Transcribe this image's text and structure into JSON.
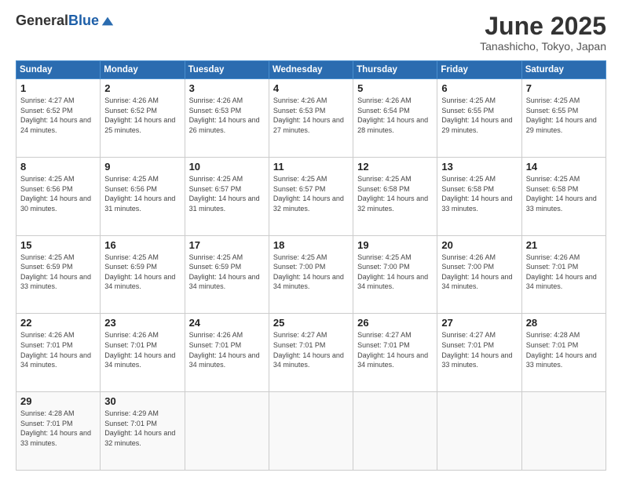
{
  "header": {
    "logo_general": "General",
    "logo_blue": "Blue",
    "month_title": "June 2025",
    "location": "Tanashicho, Tokyo, Japan"
  },
  "weekdays": [
    "Sunday",
    "Monday",
    "Tuesday",
    "Wednesday",
    "Thursday",
    "Friday",
    "Saturday"
  ],
  "weeks": [
    [
      {
        "num": "1",
        "sunrise": "4:27 AM",
        "sunset": "6:52 PM",
        "daylight": "14 hours and 24 minutes."
      },
      {
        "num": "2",
        "sunrise": "4:26 AM",
        "sunset": "6:52 PM",
        "daylight": "14 hours and 25 minutes."
      },
      {
        "num": "3",
        "sunrise": "4:26 AM",
        "sunset": "6:53 PM",
        "daylight": "14 hours and 26 minutes."
      },
      {
        "num": "4",
        "sunrise": "4:26 AM",
        "sunset": "6:53 PM",
        "daylight": "14 hours and 27 minutes."
      },
      {
        "num": "5",
        "sunrise": "4:26 AM",
        "sunset": "6:54 PM",
        "daylight": "14 hours and 28 minutes."
      },
      {
        "num": "6",
        "sunrise": "4:25 AM",
        "sunset": "6:55 PM",
        "daylight": "14 hours and 29 minutes."
      },
      {
        "num": "7",
        "sunrise": "4:25 AM",
        "sunset": "6:55 PM",
        "daylight": "14 hours and 29 minutes."
      }
    ],
    [
      {
        "num": "8",
        "sunrise": "4:25 AM",
        "sunset": "6:56 PM",
        "daylight": "14 hours and 30 minutes."
      },
      {
        "num": "9",
        "sunrise": "4:25 AM",
        "sunset": "6:56 PM",
        "daylight": "14 hours and 31 minutes."
      },
      {
        "num": "10",
        "sunrise": "4:25 AM",
        "sunset": "6:57 PM",
        "daylight": "14 hours and 31 minutes."
      },
      {
        "num": "11",
        "sunrise": "4:25 AM",
        "sunset": "6:57 PM",
        "daylight": "14 hours and 32 minutes."
      },
      {
        "num": "12",
        "sunrise": "4:25 AM",
        "sunset": "6:58 PM",
        "daylight": "14 hours and 32 minutes."
      },
      {
        "num": "13",
        "sunrise": "4:25 AM",
        "sunset": "6:58 PM",
        "daylight": "14 hours and 33 minutes."
      },
      {
        "num": "14",
        "sunrise": "4:25 AM",
        "sunset": "6:58 PM",
        "daylight": "14 hours and 33 minutes."
      }
    ],
    [
      {
        "num": "15",
        "sunrise": "4:25 AM",
        "sunset": "6:59 PM",
        "daylight": "14 hours and 33 minutes."
      },
      {
        "num": "16",
        "sunrise": "4:25 AM",
        "sunset": "6:59 PM",
        "daylight": "14 hours and 34 minutes."
      },
      {
        "num": "17",
        "sunrise": "4:25 AM",
        "sunset": "6:59 PM",
        "daylight": "14 hours and 34 minutes."
      },
      {
        "num": "18",
        "sunrise": "4:25 AM",
        "sunset": "7:00 PM",
        "daylight": "14 hours and 34 minutes."
      },
      {
        "num": "19",
        "sunrise": "4:25 AM",
        "sunset": "7:00 PM",
        "daylight": "14 hours and 34 minutes."
      },
      {
        "num": "20",
        "sunrise": "4:26 AM",
        "sunset": "7:00 PM",
        "daylight": "14 hours and 34 minutes."
      },
      {
        "num": "21",
        "sunrise": "4:26 AM",
        "sunset": "7:01 PM",
        "daylight": "14 hours and 34 minutes."
      }
    ],
    [
      {
        "num": "22",
        "sunrise": "4:26 AM",
        "sunset": "7:01 PM",
        "daylight": "14 hours and 34 minutes."
      },
      {
        "num": "23",
        "sunrise": "4:26 AM",
        "sunset": "7:01 PM",
        "daylight": "14 hours and 34 minutes."
      },
      {
        "num": "24",
        "sunrise": "4:26 AM",
        "sunset": "7:01 PM",
        "daylight": "14 hours and 34 minutes."
      },
      {
        "num": "25",
        "sunrise": "4:27 AM",
        "sunset": "7:01 PM",
        "daylight": "14 hours and 34 minutes."
      },
      {
        "num": "26",
        "sunrise": "4:27 AM",
        "sunset": "7:01 PM",
        "daylight": "14 hours and 34 minutes."
      },
      {
        "num": "27",
        "sunrise": "4:27 AM",
        "sunset": "7:01 PM",
        "daylight": "14 hours and 33 minutes."
      },
      {
        "num": "28",
        "sunrise": "4:28 AM",
        "sunset": "7:01 PM",
        "daylight": "14 hours and 33 minutes."
      }
    ],
    [
      {
        "num": "29",
        "sunrise": "4:28 AM",
        "sunset": "7:01 PM",
        "daylight": "14 hours and 33 minutes."
      },
      {
        "num": "30",
        "sunrise": "4:29 AM",
        "sunset": "7:01 PM",
        "daylight": "14 hours and 32 minutes."
      },
      null,
      null,
      null,
      null,
      null
    ]
  ]
}
